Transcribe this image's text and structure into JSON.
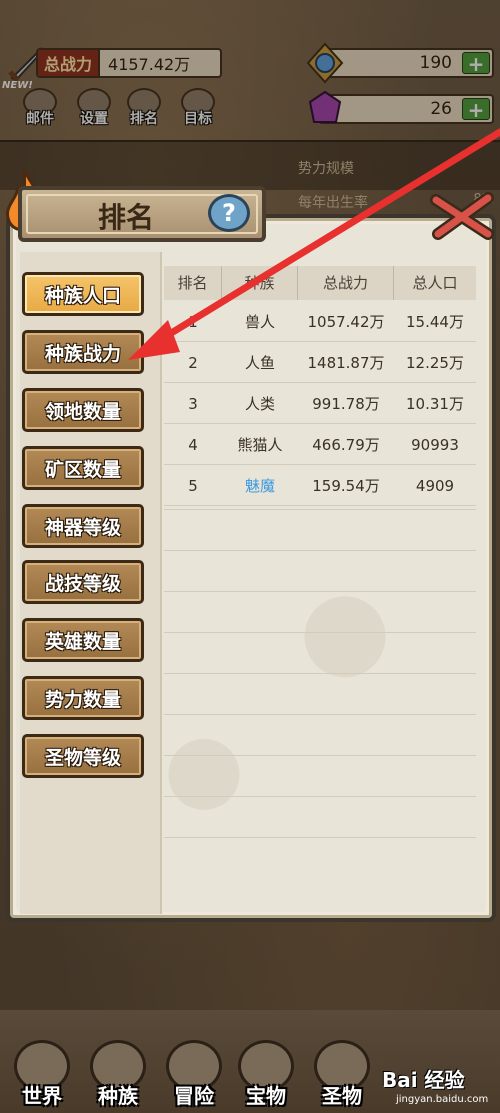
{
  "hud": {
    "power_label": "总战力",
    "power_value": "4157.42万",
    "resource1_value": "190",
    "resource2_value": "26",
    "plus": "+",
    "new_badge": "NEW!"
  },
  "menu": [
    {
      "label": "邮件"
    },
    {
      "label": "设置"
    },
    {
      "label": "排名"
    },
    {
      "label": "目标"
    }
  ],
  "background_text": {
    "line1": "势力规模",
    "line2": "每年出生率",
    "line3": "8%"
  },
  "panel": {
    "title": "排名",
    "help_symbol": "?"
  },
  "categories": [
    {
      "label": "种族人口",
      "active": true
    },
    {
      "label": "种族战力",
      "active": false
    },
    {
      "label": "领地数量",
      "active": false
    },
    {
      "label": "矿区数量",
      "active": false
    },
    {
      "label": "神器等级",
      "active": false
    },
    {
      "label": "战技等级",
      "active": false
    },
    {
      "label": "英雄数量",
      "active": false
    },
    {
      "label": "势力数量",
      "active": false
    },
    {
      "label": "圣物等级",
      "active": false
    }
  ],
  "table": {
    "headers": [
      "排名",
      "种族",
      "总战力",
      "总人口"
    ],
    "rows": [
      {
        "rank": "1",
        "race": "兽人",
        "power": "1057.42万",
        "population": "15.44万"
      },
      {
        "rank": "2",
        "race": "人鱼",
        "power": "1481.87万",
        "population": "12.25万"
      },
      {
        "rank": "3",
        "race": "人类",
        "power": "991.78万",
        "population": "10.31万"
      },
      {
        "rank": "4",
        "race": "熊猫人",
        "power": "466.79万",
        "population": "90993"
      },
      {
        "rank": "5",
        "race": "魅魔",
        "power": "159.54万",
        "population": "4909"
      }
    ]
  },
  "bottom_nav": [
    {
      "label": "世界"
    },
    {
      "label": "种族"
    },
    {
      "label": "冒险"
    },
    {
      "label": "宝物"
    },
    {
      "label": "圣物"
    }
  ],
  "watermark": {
    "logo": "Bai 经验",
    "url": "jingyan.baidu.com"
  },
  "colors": {
    "highlight_race": "#3a9ae0",
    "active_tab": "#f0b653",
    "arrow": "#e8312f"
  }
}
